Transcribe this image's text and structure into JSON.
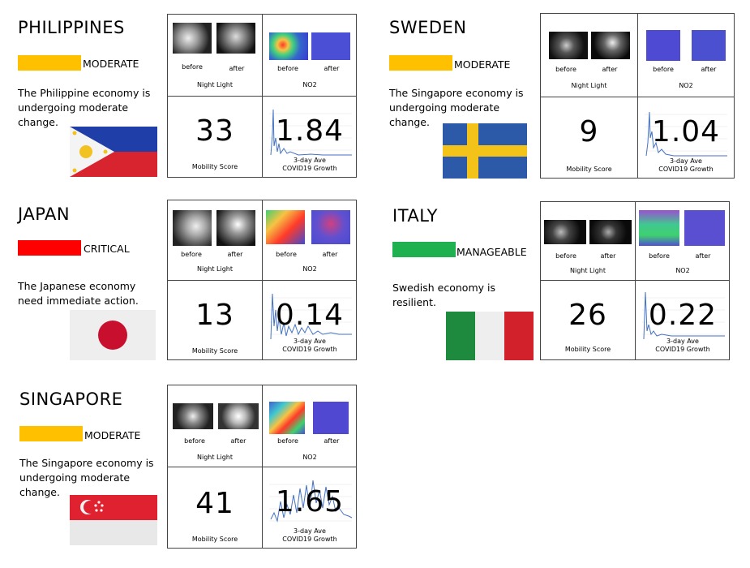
{
  "labels": {
    "night_light": "Night Light",
    "no2": "NO2",
    "before": "before",
    "after": "after",
    "mobility_score": "Mobility Score",
    "growth_line1": "3-day Ave",
    "growth_line2": "COVID19 Growth"
  },
  "status_colors": {
    "MODERATE": "#ffc000",
    "CRITICAL": "#ff0000",
    "MANAGEABLE": "#1fb150"
  },
  "cards": [
    {
      "country": "PHILIPPINES",
      "status": "MODERATE",
      "description": "The Philippine economy is undergoing moderate change.",
      "flag": "philippines-flag",
      "mobility_score": "33",
      "covid_growth": "1.84"
    },
    {
      "country": "SWEDEN",
      "status": "MODERATE",
      "description": "The Singapore economy is undergoing moderate change.",
      "flag": "sweden-flag",
      "mobility_score": "9",
      "covid_growth": "1.04"
    },
    {
      "country": "JAPAN",
      "status": "CRITICAL",
      "description": "The Japanese economy need immediate action.",
      "flag": "japan-flag",
      "mobility_score": "13",
      "covid_growth": "0.14"
    },
    {
      "country": "ITALY",
      "status": "MANAGEABLE",
      "description": "Swedish economy is resilient.",
      "flag": "italy-flag",
      "mobility_score": "26",
      "covid_growth": "0.22"
    },
    {
      "country": "SINGAPORE",
      "status": "MODERATE",
      "description": "The Singapore economy is undergoing moderate change.",
      "flag": "singapore-flag",
      "mobility_score": "41",
      "covid_growth": "1.65"
    }
  ]
}
